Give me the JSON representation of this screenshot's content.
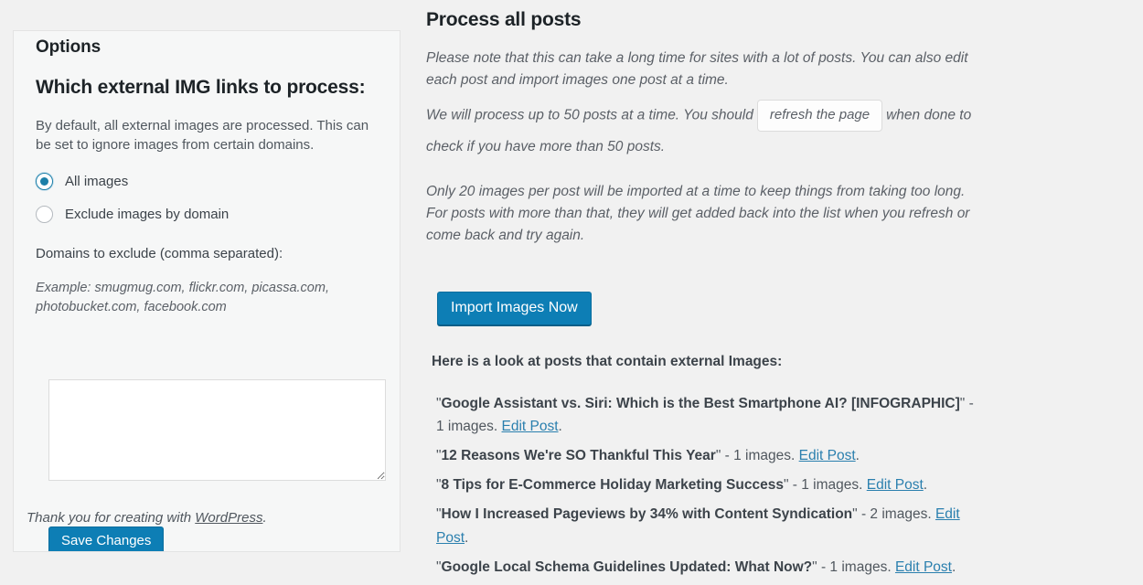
{
  "options_panel": {
    "title": "Options",
    "subtitle": "Which external IMG links to process:",
    "description": "By default, all external images are processed. This can be set to ignore images from certain domains.",
    "radios": [
      {
        "label": "All images",
        "checked": true
      },
      {
        "label": "Exclude images by domain",
        "checked": false
      }
    ],
    "domains_label": "Domains to exclude (comma separated):",
    "example_text": "Example: smugmug.com, flickr.com, picassa.com, photobucket.com, facebook.com",
    "textarea_value": "",
    "textarea_placeholder": "",
    "thankyou_prefix": "Thank you for creating with ",
    "thankyou_link": "WordPress",
    "thankyou_suffix": ".",
    "save_label": "Save Changes"
  },
  "process": {
    "title": "Process all posts",
    "para1": "Please note that this can take a long time for sites with a lot of posts. You can also edit each post and import images one post at a time.",
    "para2_before": "We will process up to 50 posts at a time. You should",
    "refresh_button_label": "refresh the page",
    "para2_after": "when done to check if you have more than 50 posts.",
    "para3": "Only 20 images per post will be imported at a time to keep things from taking too long. For posts with more than that, they will get added back into the list when you refresh or come back and try again.",
    "import_button_label": "Import Images Now",
    "posts_heading": "Here is a look at posts that contain external Images:",
    "posts": [
      {
        "title": "Google Assistant vs. Siri: Which is the Best Smartphone AI? [INFOGRAPHIC]",
        "count_text": "- 1 images.",
        "edit_label": "Edit Post"
      },
      {
        "title": "12 Reasons We're SO Thankful This Year",
        "count_text": "- 1 images.",
        "edit_label": "Edit Post"
      },
      {
        "title": "8 Tips for E-Commerce Holiday Marketing Success",
        "count_text": "- 1 images.",
        "edit_label": "Edit Post"
      },
      {
        "title": "How I Increased Pageviews by 34% with Content Syndication",
        "count_text": "- 2 images.",
        "edit_label": "Edit Post"
      },
      {
        "title": "Google Local Schema Guidelines Updated: What Now?",
        "count_text": "- 1 images.",
        "edit_label": "Edit Post"
      }
    ]
  },
  "colors": {
    "page_background": "#f1f1f1",
    "panel_background": "#f6f7f7",
    "primary_button": "#0d7eb5",
    "link": "#2a7fae",
    "radio_accent": "#1b7fa8",
    "heading_text": "#1d2327",
    "body_text": "#50575e"
  }
}
